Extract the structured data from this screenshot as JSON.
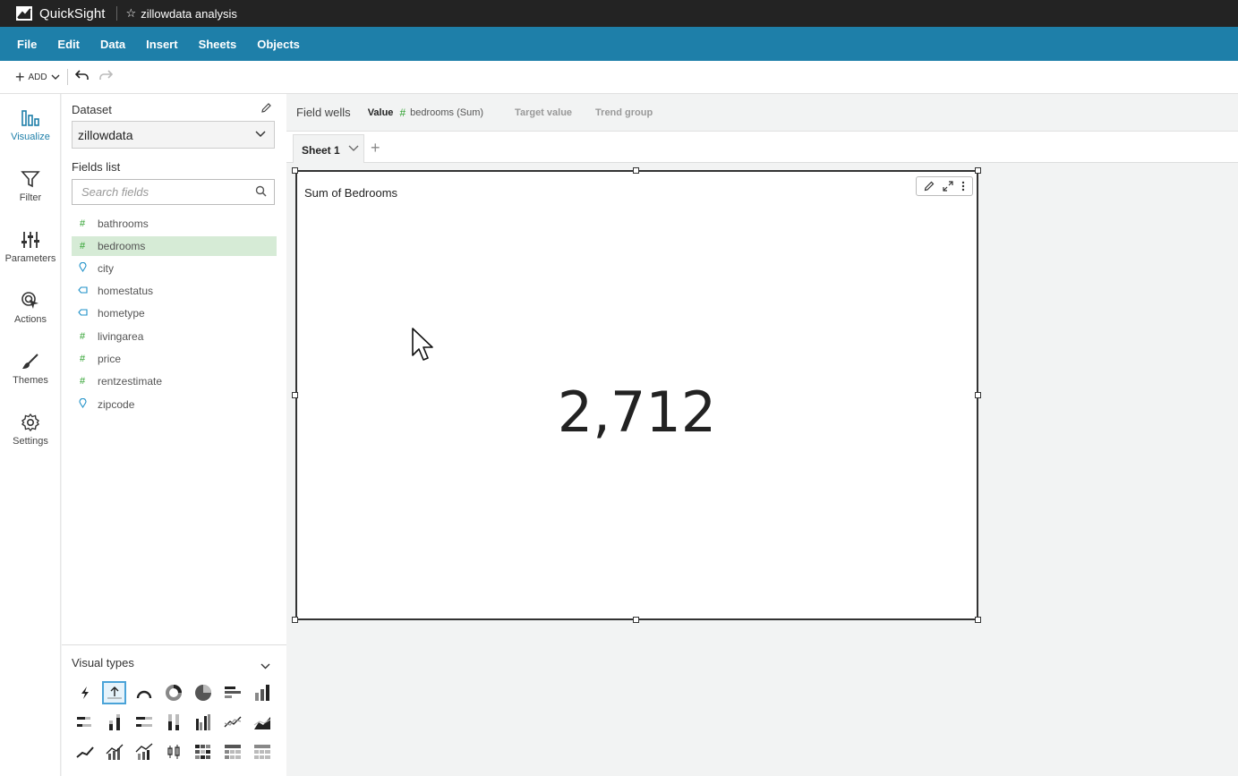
{
  "titlebar": {
    "app_name": "QuickSight",
    "analysis_name": "zillowdata analysis"
  },
  "menubar": {
    "items": [
      "File",
      "Edit",
      "Data",
      "Insert",
      "Sheets",
      "Objects"
    ]
  },
  "toolbar": {
    "add_label": "ADD"
  },
  "rail": {
    "items": [
      {
        "label": "Visualize",
        "icon": "bar-chart-icon"
      },
      {
        "label": "Filter",
        "icon": "funnel-icon"
      },
      {
        "label": "Parameters",
        "icon": "sliders-icon"
      },
      {
        "label": "Actions",
        "icon": "target-cursor-icon"
      },
      {
        "label": "Themes",
        "icon": "paintbrush-icon"
      },
      {
        "label": "Settings",
        "icon": "gear-icon"
      }
    ]
  },
  "fields_panel": {
    "dataset_label": "Dataset",
    "dataset_value": "zillowdata",
    "fields_list_label": "Fields list",
    "search_placeholder": "Search fields",
    "fields": [
      {
        "name": "bathrooms",
        "type": "numeric",
        "icon": "#"
      },
      {
        "name": "bedrooms",
        "type": "numeric",
        "icon": "#"
      },
      {
        "name": "city",
        "type": "geo",
        "icon": "geo-pin-icon"
      },
      {
        "name": "homestatus",
        "type": "dimension",
        "icon": "tag-icon"
      },
      {
        "name": "hometype",
        "type": "dimension",
        "icon": "tag-icon"
      },
      {
        "name": "livingarea",
        "type": "numeric",
        "icon": "#"
      },
      {
        "name": "price",
        "type": "numeric",
        "icon": "#"
      },
      {
        "name": "rentzestimate",
        "type": "numeric",
        "icon": "#"
      },
      {
        "name": "zipcode",
        "type": "geo",
        "icon": "geo-pin-icon"
      }
    ]
  },
  "visual_types": {
    "label": "Visual types"
  },
  "field_wells": {
    "title": "Field wells",
    "value_label": "Value",
    "value_field": "bedrooms (Sum)",
    "target_label": "Target value",
    "trend_label": "Trend group"
  },
  "sheets": {
    "active_tab": "Sheet 1"
  },
  "visual": {
    "title": "Sum of Bedrooms",
    "kpi_value": "2,712"
  },
  "colors": {
    "menubar": "#1e7fa9",
    "titlebar": "#232323",
    "selected_field": "#d6ebd6",
    "numeric_icon": "#2ca02c"
  }
}
